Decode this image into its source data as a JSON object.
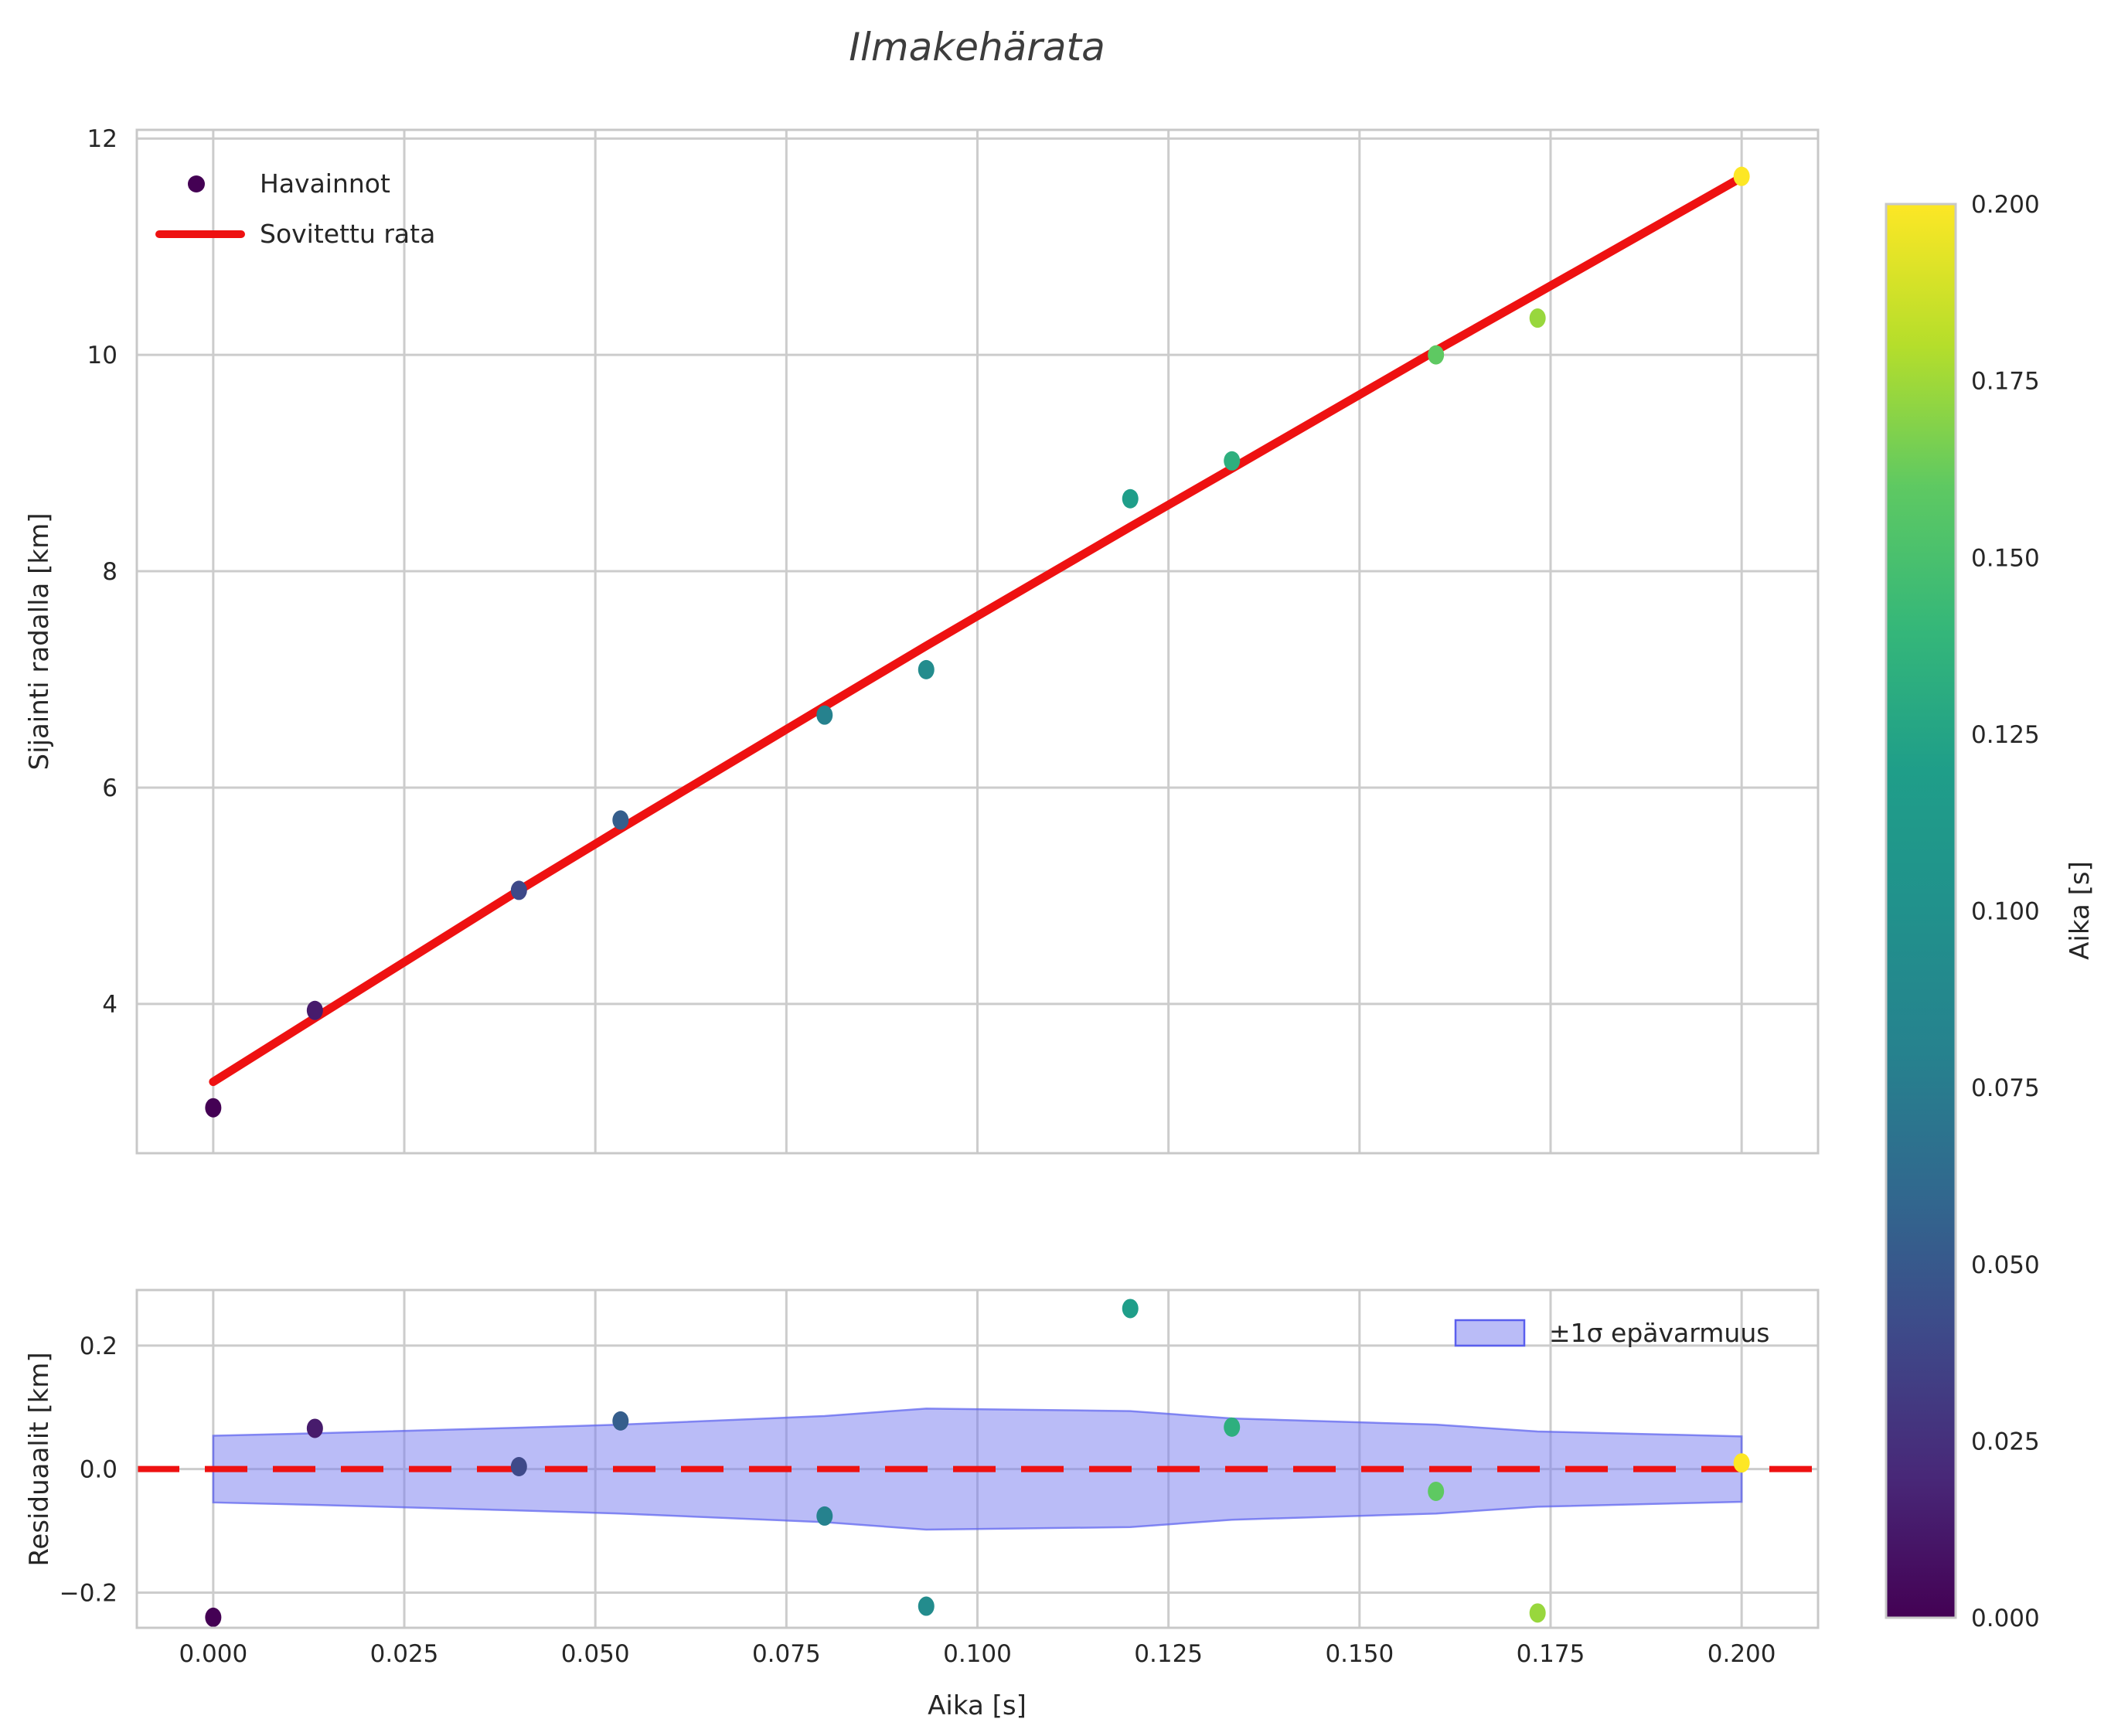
{
  "title": "Ilmakehärata",
  "top_plot": {
    "ylabel": "Sijainti radalla [km]",
    "ytick_labels": [
      "4",
      "6",
      "8",
      "10",
      "12"
    ],
    "yticks": [
      4,
      6,
      8,
      10,
      12
    ],
    "ylim": [
      2.62,
      12.08
    ],
    "legend": {
      "observations": "Havainnot",
      "fit": "Sovitettu rata"
    }
  },
  "residual_plot": {
    "ylabel": "Residuaalit [km]",
    "ytick_labels": [
      "−0.2",
      "0.0",
      "0.2"
    ],
    "yticks": [
      -0.2,
      0.0,
      0.2
    ],
    "ylim": [
      -0.257,
      0.29
    ],
    "legend_band": "±1σ epävarmuus"
  },
  "x_axis": {
    "label": "Aika [s]",
    "tick_labels": [
      "0.000",
      "0.025",
      "0.050",
      "0.075",
      "0.100",
      "0.125",
      "0.150",
      "0.175",
      "0.200"
    ],
    "ticks": [
      0.0,
      0.025,
      0.05,
      0.075,
      0.1,
      0.125,
      0.15,
      0.175,
      0.2
    ],
    "xlim": [
      -0.01,
      0.21
    ]
  },
  "colorbar": {
    "label": "Aika [s]",
    "tick_labels": [
      "0.000",
      "0.025",
      "0.050",
      "0.075",
      "0.100",
      "0.125",
      "0.150",
      "0.175",
      "0.200"
    ],
    "ticks": [
      0.0,
      0.025,
      0.05,
      0.075,
      0.1,
      0.125,
      0.15,
      0.175,
      0.2
    ],
    "min": 0.0,
    "max": 0.2
  },
  "colors": {
    "fit_line": "#ee1111",
    "zero_line": "#ee1111",
    "band_fill": "#7579f0",
    "band_fill_opacity": 0.5,
    "band_edge": "#5a5fee",
    "grid": "#cccccc",
    "spine": "#c8c8c8",
    "text": "#262626",
    "legend_dot": "#440154",
    "viridis_stops": [
      [
        0.0,
        "#440154"
      ],
      [
        0.1,
        "#482878"
      ],
      [
        0.2,
        "#3e4989"
      ],
      [
        0.3,
        "#31688e"
      ],
      [
        0.4,
        "#26828e"
      ],
      [
        0.5,
        "#21918c"
      ],
      [
        0.6,
        "#1f9e89"
      ],
      [
        0.7,
        "#35b779"
      ],
      [
        0.8,
        "#5ec962"
      ],
      [
        0.9,
        "#b5de2b"
      ],
      [
        1.0,
        "#fde725"
      ]
    ]
  },
  "chart_data": {
    "type": "scatter",
    "title": "Ilmakehärata",
    "xlabel": "Aika [s]",
    "ylabel": "Sijainti radalla [km]",
    "grid": true,
    "xlim": [
      -0.01,
      0.21
    ],
    "ylim_top": [
      2.62,
      12.08
    ],
    "ylim_residual": [
      -0.257,
      0.29
    ],
    "legend_position_top": "upper left",
    "legend_position_residual": "upper right",
    "x": [
      0.0,
      0.0133,
      0.04,
      0.0533,
      0.08,
      0.0933,
      0.12,
      0.1333,
      0.16,
      0.1733,
      0.2
    ],
    "series": [
      {
        "name": "Havainnot",
        "type": "scatter",
        "values": [
          3.04,
          3.94,
          5.05,
          5.7,
          6.67,
          7.09,
          8.67,
          9.02,
          10.0,
          10.34,
          11.65
        ],
        "color_by": "x",
        "colormap": "viridis"
      },
      {
        "name": "Sovitettu rata",
        "type": "line",
        "values": [
          3.28,
          3.87,
          5.05,
          5.62,
          6.75,
          7.31,
          8.41,
          8.95,
          10.04,
          10.57,
          11.64
        ],
        "color": "#ee1111"
      }
    ],
    "residuals": {
      "name": "Residuaalit",
      "values": [
        -0.24,
        0.066,
        0.004,
        0.078,
        -0.076,
        -0.222,
        0.26,
        0.068,
        -0.036,
        -0.233,
        0.01
      ],
      "band_halfwidth": [
        0.054,
        0.058,
        0.067,
        0.072,
        0.086,
        0.098,
        0.094,
        0.082,
        0.072,
        0.061,
        0.053
      ],
      "band_label": "±1σ epävarmuus",
      "zero_line": 0.0
    },
    "colorbar": {
      "label": "Aika [s]",
      "min": 0.0,
      "max": 0.2
    }
  }
}
